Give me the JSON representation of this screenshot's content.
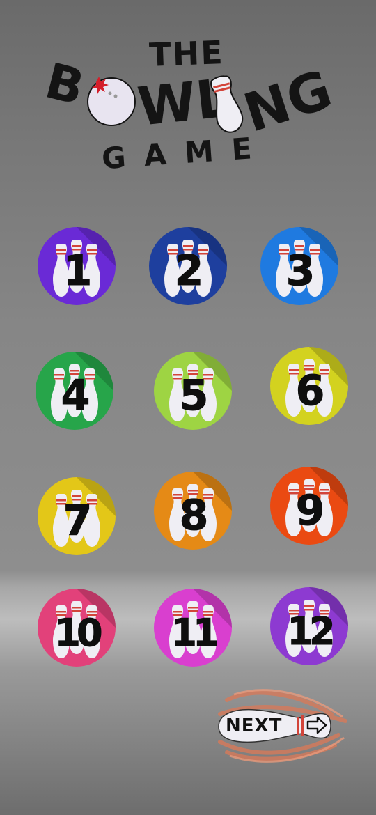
{
  "title": {
    "line1": "THE",
    "line2_left": "B",
    "line2_right": "WL",
    "line2_end": "NG",
    "line3": "GAME"
  },
  "levels": [
    {
      "label": "1",
      "color": "#6a2ad6"
    },
    {
      "label": "2",
      "color": "#1e3f9e"
    },
    {
      "label": "3",
      "color": "#1f7ae0"
    },
    {
      "label": "4",
      "color": "#27a54a"
    },
    {
      "label": "5",
      "color": "#9ed443"
    },
    {
      "label": "6",
      "color": "#d3d21f"
    },
    {
      "label": "7",
      "color": "#e3c718"
    },
    {
      "label": "8",
      "color": "#e58a16"
    },
    {
      "label": "9",
      "color": "#ea4a12"
    },
    {
      "label": "10",
      "color": "#e2417a"
    },
    {
      "label": "11",
      "color": "#d93fcf"
    },
    {
      "label": "12",
      "color": "#8d3ad1"
    }
  ],
  "next": {
    "label": "NEXT"
  },
  "colors": {
    "pin_white": "#efeef4",
    "pin_stripe": "#d2443a",
    "ball": "#e8e4f0",
    "ball_hole": "#d41e2a",
    "flame": "#d77a5a"
  }
}
